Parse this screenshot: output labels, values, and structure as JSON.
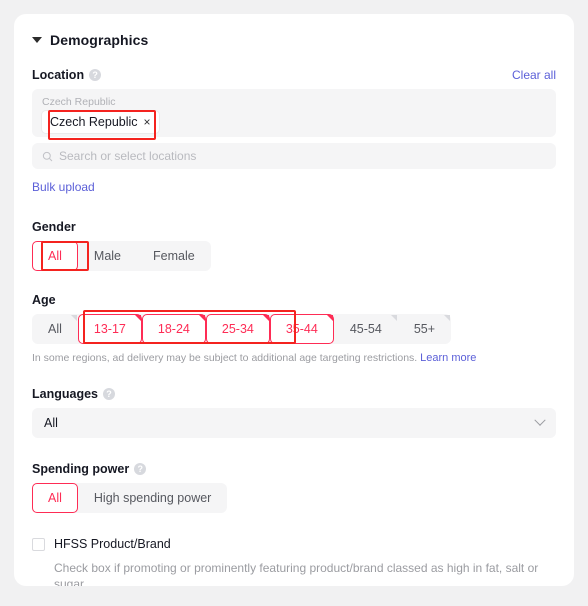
{
  "section": {
    "title": "Demographics",
    "caret_icon": "caret-down-icon"
  },
  "location": {
    "label": "Location",
    "help_icon": "help-circle-icon",
    "clear_all": "Clear all",
    "group_label": "Czech Republic",
    "chip": {
      "text": "Czech Republic",
      "remove_icon": "×"
    },
    "search_placeholder": "Search or select locations",
    "search_icon": "search-icon",
    "bulk_upload": "Bulk upload"
  },
  "gender": {
    "label": "Gender",
    "options": [
      {
        "label": "All",
        "selected": true
      },
      {
        "label": "Male",
        "selected": false
      },
      {
        "label": "Female",
        "selected": false
      }
    ]
  },
  "age": {
    "label": "Age",
    "options": [
      {
        "label": "All",
        "selected": false
      },
      {
        "label": "13-17",
        "selected": true
      },
      {
        "label": "18-24",
        "selected": true
      },
      {
        "label": "25-34",
        "selected": true
      },
      {
        "label": "35-44",
        "selected": true
      },
      {
        "label": "45-54",
        "selected": false
      },
      {
        "label": "55+",
        "selected": false
      }
    ],
    "hint": "In some regions, ad delivery may be subject to additional age targeting restrictions.",
    "hint_link": "Learn more"
  },
  "languages": {
    "label": "Languages",
    "help_icon": "help-circle-icon",
    "value": "All",
    "chevron_icon": "chevron-down-icon"
  },
  "spending_power": {
    "label": "Spending power",
    "help_icon": "help-circle-icon",
    "options": [
      {
        "label": "All",
        "selected": true
      },
      {
        "label": "High spending power",
        "selected": false
      }
    ]
  },
  "hfss": {
    "label": "HFSS Product/Brand",
    "checked": false,
    "description": "Check box if promoting or prominently featuring product/brand classed as high in fat, salt or sugar."
  },
  "colors": {
    "accent_pink": "#fe2c55",
    "link_blue": "#5b5fd8",
    "annotation_red": "#f4231f",
    "field_bg": "#f5f5f6",
    "page_bg": "#f1f1f2"
  }
}
